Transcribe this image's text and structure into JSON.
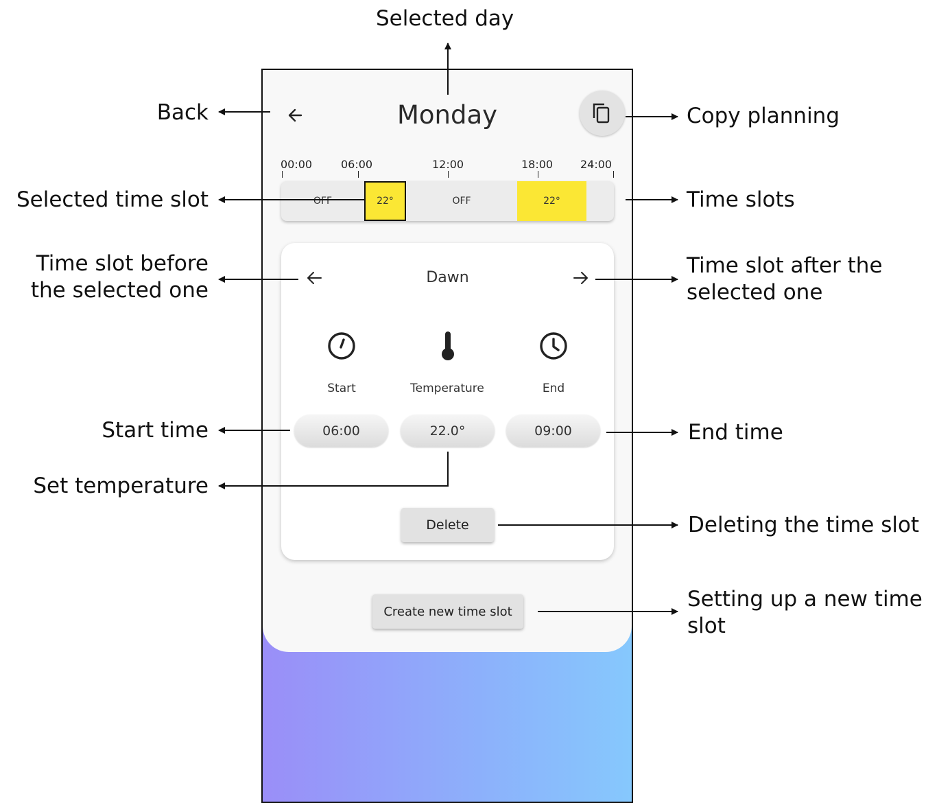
{
  "header": {
    "title": "Monday",
    "back_icon": "arrow-left-icon",
    "copy_icon": "copy-icon"
  },
  "timeline": {
    "ticks": [
      "00:00",
      "06:00",
      "12:00",
      "18:00",
      "24:00"
    ],
    "slots": [
      {
        "label": "OFF",
        "start": "00:00",
        "end": "06:00",
        "selected": false
      },
      {
        "label": "22°",
        "start": "06:00",
        "end": "09:00",
        "selected": true
      },
      {
        "label": "OFF",
        "start": "09:00",
        "end": "17:00",
        "selected": false
      },
      {
        "label": "22°",
        "start": "17:00",
        "end": "22:00",
        "selected": false
      }
    ],
    "heat_color": "#fbe734"
  },
  "detail": {
    "name": "Dawn",
    "prev_icon": "arrow-left-icon",
    "next_icon": "arrow-right-icon",
    "start_label": "Start",
    "temperature_label": "Temperature",
    "end_label": "End",
    "start_value": "06:00",
    "temperature_value": "22.0°",
    "end_value": "09:00",
    "delete_label": "Delete"
  },
  "create_label": "Create new time slot",
  "colors": {
    "gradient_start": "#9a8ef8",
    "gradient_end": "#86c8fd",
    "panel": "#f8f8f8"
  },
  "annotations": {
    "selected_day": "Selected day",
    "back": "Back",
    "copy_planning": "Copy planning",
    "selected_time_slot": "Selected time slot",
    "time_slots": "Time slots",
    "before_1": "Time slot before",
    "before_2": "the selected one",
    "after_1": "Time slot after the",
    "after_2": "selected one",
    "start_time": "Start time",
    "end_time": "End time",
    "set_temperature": "Set temperature",
    "deleting": "Deleting the time slot",
    "new_1": "Setting up a new time",
    "new_2": "slot"
  }
}
